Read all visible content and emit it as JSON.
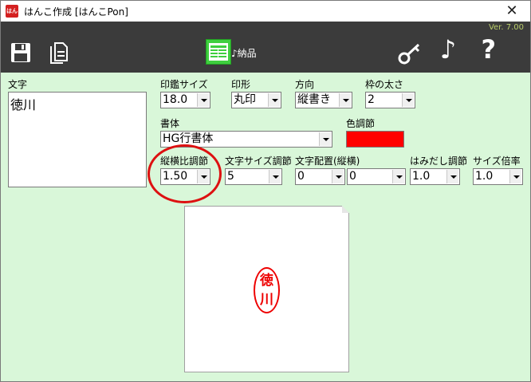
{
  "window": {
    "title": "はんこ作成 [はんこPon]",
    "app_icon_glyph": "はん",
    "close_glyph": "✕"
  },
  "toolbar": {
    "version": "Ver. 7.00",
    "nouhin_label": "♪納品",
    "music_glyph": "♪",
    "help_glyph": "?",
    "icons": [
      "save-icon",
      "document-icon",
      "nouhin-icon",
      "key-icon",
      "music-icon",
      "help-icon"
    ]
  },
  "form": {
    "text_label": "文字",
    "text_value": "徳川",
    "print_size": {
      "label": "印鑑サイズ",
      "value": "18.0"
    },
    "shape": {
      "label": "印形",
      "value": "丸印"
    },
    "direction": {
      "label": "方向",
      "value": "縦書き"
    },
    "frame_width": {
      "label": "枠の太さ",
      "value": "2"
    },
    "font": {
      "label": "書体",
      "value": "HG行書体"
    },
    "color": {
      "label": "色調節",
      "value": "#ff0000"
    },
    "aspect": {
      "label": "縦横比調節",
      "value": "1.50"
    },
    "char_size": {
      "label": "文字サイズ調節",
      "value": "5"
    },
    "placement": {
      "label": "文字配置(縦横)",
      "value_v": "0",
      "value_h": "0"
    },
    "overflow": {
      "label": "はみだし調節",
      "value": "1.0"
    },
    "size_scale": {
      "label": "サイズ倍率",
      "value": "1.0"
    }
  },
  "preview": {
    "stamp_chars": [
      "徳",
      "川"
    ],
    "stamp_color": "#ee0000"
  },
  "annotation": {
    "color": "#dd1111"
  }
}
